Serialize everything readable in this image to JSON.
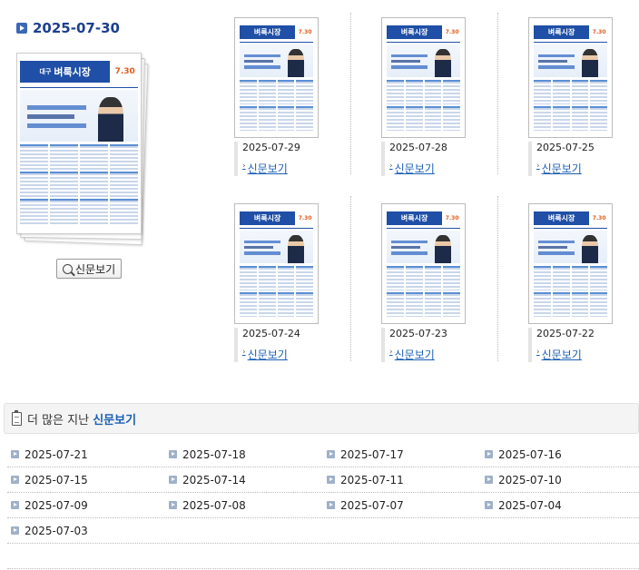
{
  "feature": {
    "date": "2025-07-30",
    "paper": {
      "region": "대구",
      "name": "벼룩시장",
      "issue": "7.30"
    },
    "view_button": "신문보기"
  },
  "recent": [
    {
      "date": "2025-07-29",
      "link": "신문보기"
    },
    {
      "date": "2025-07-28",
      "link": "신문보기"
    },
    {
      "date": "2025-07-25",
      "link": "신문보기"
    },
    {
      "date": "2025-07-24",
      "link": "신문보기"
    },
    {
      "date": "2025-07-23",
      "link": "신문보기"
    },
    {
      "date": "2025-07-22",
      "link": "신문보기"
    }
  ],
  "more": {
    "title_prefix": "더 많은 지난",
    "title_highlight": "신문보기",
    "dates": [
      "2025-07-21",
      "2025-07-18",
      "2025-07-17",
      "2025-07-16",
      "2025-07-15",
      "2025-07-14",
      "2025-07-11",
      "2025-07-10",
      "2025-07-09",
      "2025-07-08",
      "2025-07-07",
      "2025-07-04",
      "2025-07-03"
    ]
  },
  "colors": {
    "accent": "#1a5fb4",
    "brand": "#1f4fa6",
    "date_heading": "#1c3f8e"
  }
}
